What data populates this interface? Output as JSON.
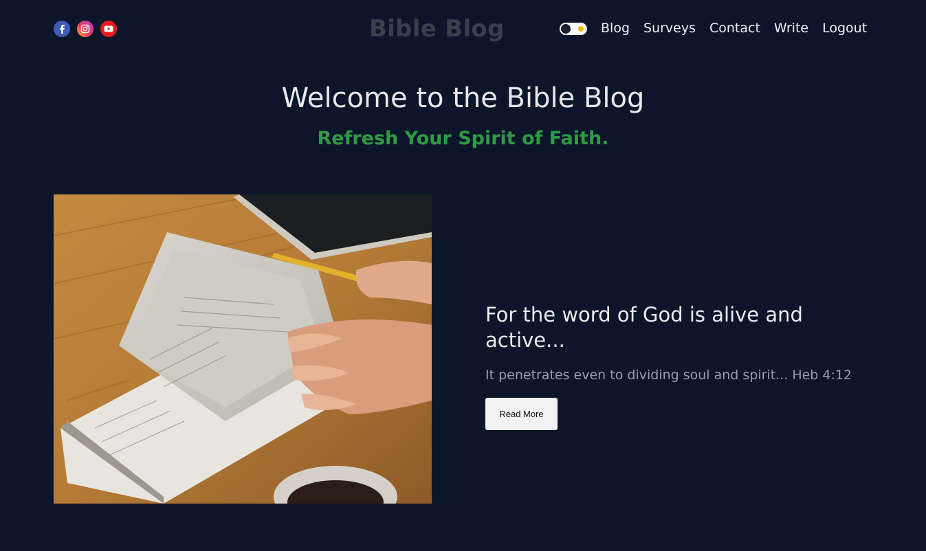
{
  "header": {
    "brand": "Bible Blog",
    "social_icons": [
      "facebook-icon",
      "instagram-icon",
      "youtube-icon"
    ],
    "theme_toggle": "theme-toggle",
    "nav": [
      {
        "label": "Blog"
      },
      {
        "label": "Surveys"
      },
      {
        "label": "Contact"
      },
      {
        "label": "Write"
      },
      {
        "label": "Logout"
      }
    ]
  },
  "hero": {
    "title": "Welcome to the Bible Blog",
    "subtitle": "Refresh Your Spirit of Faith."
  },
  "featured_post": {
    "title": "For the word of God is alive and active...",
    "excerpt": "It penetrates even to dividing soul and spirit... Heb 4:12",
    "read_more_label": "Read More"
  },
  "colors": {
    "background": "#0d152b",
    "accent_green": "#2f9a45",
    "brand_muted": "#3a3f4e"
  }
}
